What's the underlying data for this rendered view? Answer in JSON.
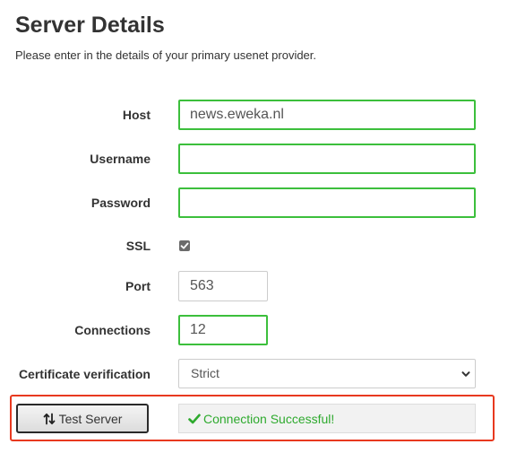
{
  "header": {
    "title": "Server Details",
    "subtitle": "Please enter in the details of your primary usenet provider."
  },
  "form": {
    "host": {
      "label": "Host",
      "value": "news.eweka.nl",
      "valid": true
    },
    "username": {
      "label": "Username",
      "value": "",
      "valid": true
    },
    "password": {
      "label": "Password",
      "value": "",
      "valid": true
    },
    "ssl": {
      "label": "SSL",
      "checked": true
    },
    "port": {
      "label": "Port",
      "value": "563",
      "valid": false
    },
    "connections": {
      "label": "Connections",
      "value": "12",
      "valid": true
    },
    "certificate_verification": {
      "label": "Certificate verification",
      "selected": "Strict",
      "options": [
        "Strict"
      ]
    }
  },
  "actions": {
    "test_server_label": "Test Server",
    "test_server_icon": "sort-arrows-icon",
    "result_text": "Connection Successful!",
    "result_icon": "checkmark-icon"
  },
  "colors": {
    "valid_border": "#3cbf3c",
    "success_text": "#2eaa2e",
    "highlight": "#e8391f",
    "checkbox_fill": "#6b6b6b"
  }
}
